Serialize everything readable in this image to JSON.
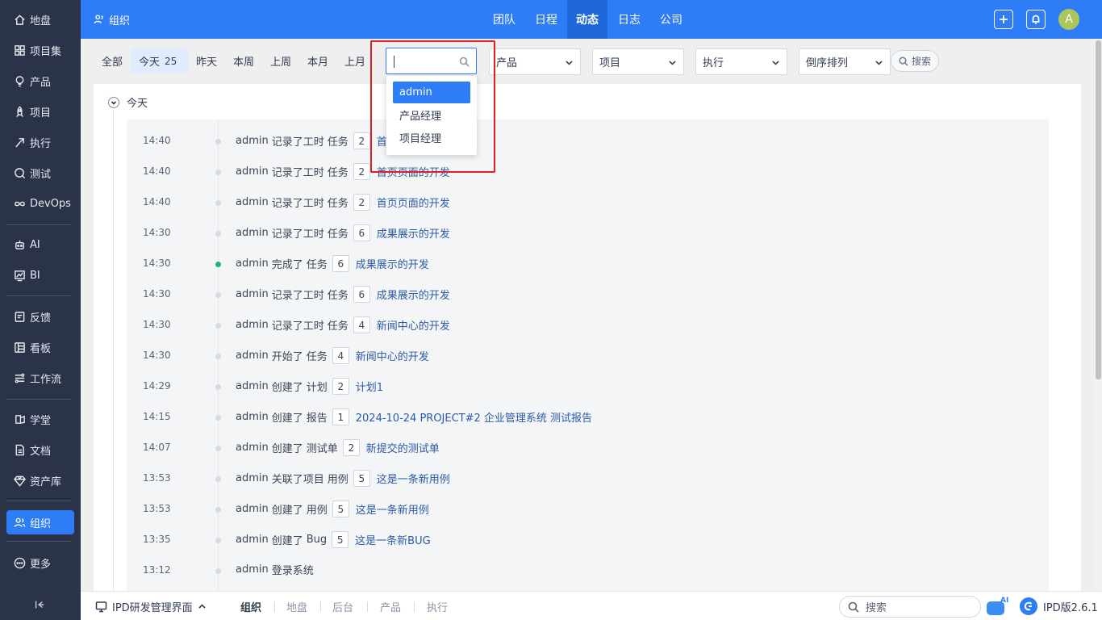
{
  "sidebar": {
    "items": [
      {
        "label": "地盘",
        "icon": "home-icon"
      },
      {
        "label": "项目集",
        "icon": "grid-icon"
      },
      {
        "label": "产品",
        "icon": "bulb-icon"
      },
      {
        "label": "项目",
        "icon": "rocket-icon"
      },
      {
        "label": "执行",
        "icon": "flag-icon"
      },
      {
        "label": "测试",
        "icon": "test-icon"
      },
      {
        "label": "DevOps",
        "icon": "infinity-icon"
      },
      {
        "label": "AI",
        "icon": "robot-icon"
      },
      {
        "label": "BI",
        "icon": "chart-icon"
      },
      {
        "label": "反馈",
        "icon": "feedback-icon"
      },
      {
        "label": "看板",
        "icon": "kanban-icon"
      },
      {
        "label": "工作流",
        "icon": "workflow-icon"
      },
      {
        "label": "学堂",
        "icon": "school-icon"
      },
      {
        "label": "文档",
        "icon": "doc-icon"
      },
      {
        "label": "资产库",
        "icon": "diamond-icon"
      },
      {
        "label": "组织",
        "icon": "users-icon"
      },
      {
        "label": "更多",
        "icon": "more-icon"
      }
    ],
    "active": "组织"
  },
  "header": {
    "title": "组织",
    "tabs": [
      "团队",
      "日程",
      "动态",
      "日志",
      "公司"
    ],
    "active_tab": "动态",
    "avatar_letter": "A"
  },
  "filters": {
    "tabs": [
      "全部",
      "今天",
      "昨天",
      "本周",
      "上周",
      "本月",
      "上月"
    ],
    "active_tab": "今天",
    "today_count": "25",
    "product_select": "产品",
    "project_select": "项目",
    "execution_select": "执行",
    "order_select": "倒序排列",
    "search_label": "搜索"
  },
  "user_dropdown": {
    "input_value": "",
    "options": [
      "admin",
      "产品经理",
      "项目经理"
    ],
    "selected": "admin"
  },
  "day_group": "今天",
  "actions": [
    {
      "time": "14:40",
      "actor": "admin",
      "action": "记录了工时",
      "type": "任务",
      "id": "2",
      "name": "首页页面的开发",
      "status": "normal"
    },
    {
      "time": "14:40",
      "actor": "admin",
      "action": "记录了工时",
      "type": "任务",
      "id": "2",
      "name": "首页页面的开发",
      "status": "normal"
    },
    {
      "time": "14:40",
      "actor": "admin",
      "action": "记录了工时",
      "type": "任务",
      "id": "2",
      "name": "首页页面的开发",
      "status": "normal"
    },
    {
      "time": "14:30",
      "actor": "admin",
      "action": "记录了工时",
      "type": "任务",
      "id": "6",
      "name": "成果展示的开发",
      "status": "normal"
    },
    {
      "time": "14:30",
      "actor": "admin",
      "action": "完成了",
      "type": "任务",
      "id": "6",
      "name": "成果展示的开发",
      "status": "done"
    },
    {
      "time": "14:30",
      "actor": "admin",
      "action": "记录了工时",
      "type": "任务",
      "id": "6",
      "name": "成果展示的开发",
      "status": "normal"
    },
    {
      "time": "14:30",
      "actor": "admin",
      "action": "记录了工时",
      "type": "任务",
      "id": "4",
      "name": "新闻中心的开发",
      "status": "normal"
    },
    {
      "time": "14:30",
      "actor": "admin",
      "action": "开始了",
      "type": "任务",
      "id": "4",
      "name": "新闻中心的开发",
      "status": "normal"
    },
    {
      "time": "14:29",
      "actor": "admin",
      "action": "创建了",
      "type": "计划",
      "id": "2",
      "name": "计划1",
      "status": "normal"
    },
    {
      "time": "14:15",
      "actor": "admin",
      "action": "创建了",
      "type": "报告",
      "id": "1",
      "name": "2024-10-24 PROJECT#2 企业管理系统 测试报告",
      "status": "normal"
    },
    {
      "time": "14:07",
      "actor": "admin",
      "action": "创建了",
      "type": "测试单",
      "id": "2",
      "name": "新提交的测试单",
      "status": "normal"
    },
    {
      "time": "13:53",
      "actor": "admin",
      "action": "关联了项目",
      "type": "用例",
      "id": "5",
      "name": "这是一条新用例",
      "status": "normal"
    },
    {
      "time": "13:53",
      "actor": "admin",
      "action": "创建了",
      "type": "用例",
      "id": "5",
      "name": "这是一条新用例",
      "status": "normal"
    },
    {
      "time": "13:35",
      "actor": "admin",
      "action": "创建了",
      "type": "Bug",
      "id": "5",
      "name": "这是一条新BUG",
      "status": "normal"
    },
    {
      "time": "13:12",
      "actor": "admin",
      "action": "登录系统",
      "type": "",
      "id": "",
      "name": "",
      "status": "normal"
    }
  ],
  "bottombar": {
    "app_label": "IPD研发管理界面",
    "tabs": [
      "组织",
      "地盘",
      "后台",
      "产品",
      "执行"
    ],
    "active_tab": "组织",
    "search_label": "搜索",
    "ai_badge": "AI",
    "version": "IPD版2.6.1"
  },
  "colors": {
    "primary": "#2e7cf6",
    "sidebar_bg": "#2a3347",
    "done_dot": "#22b573",
    "highlight": "#e02020",
    "link": "#2a5aa8"
  }
}
